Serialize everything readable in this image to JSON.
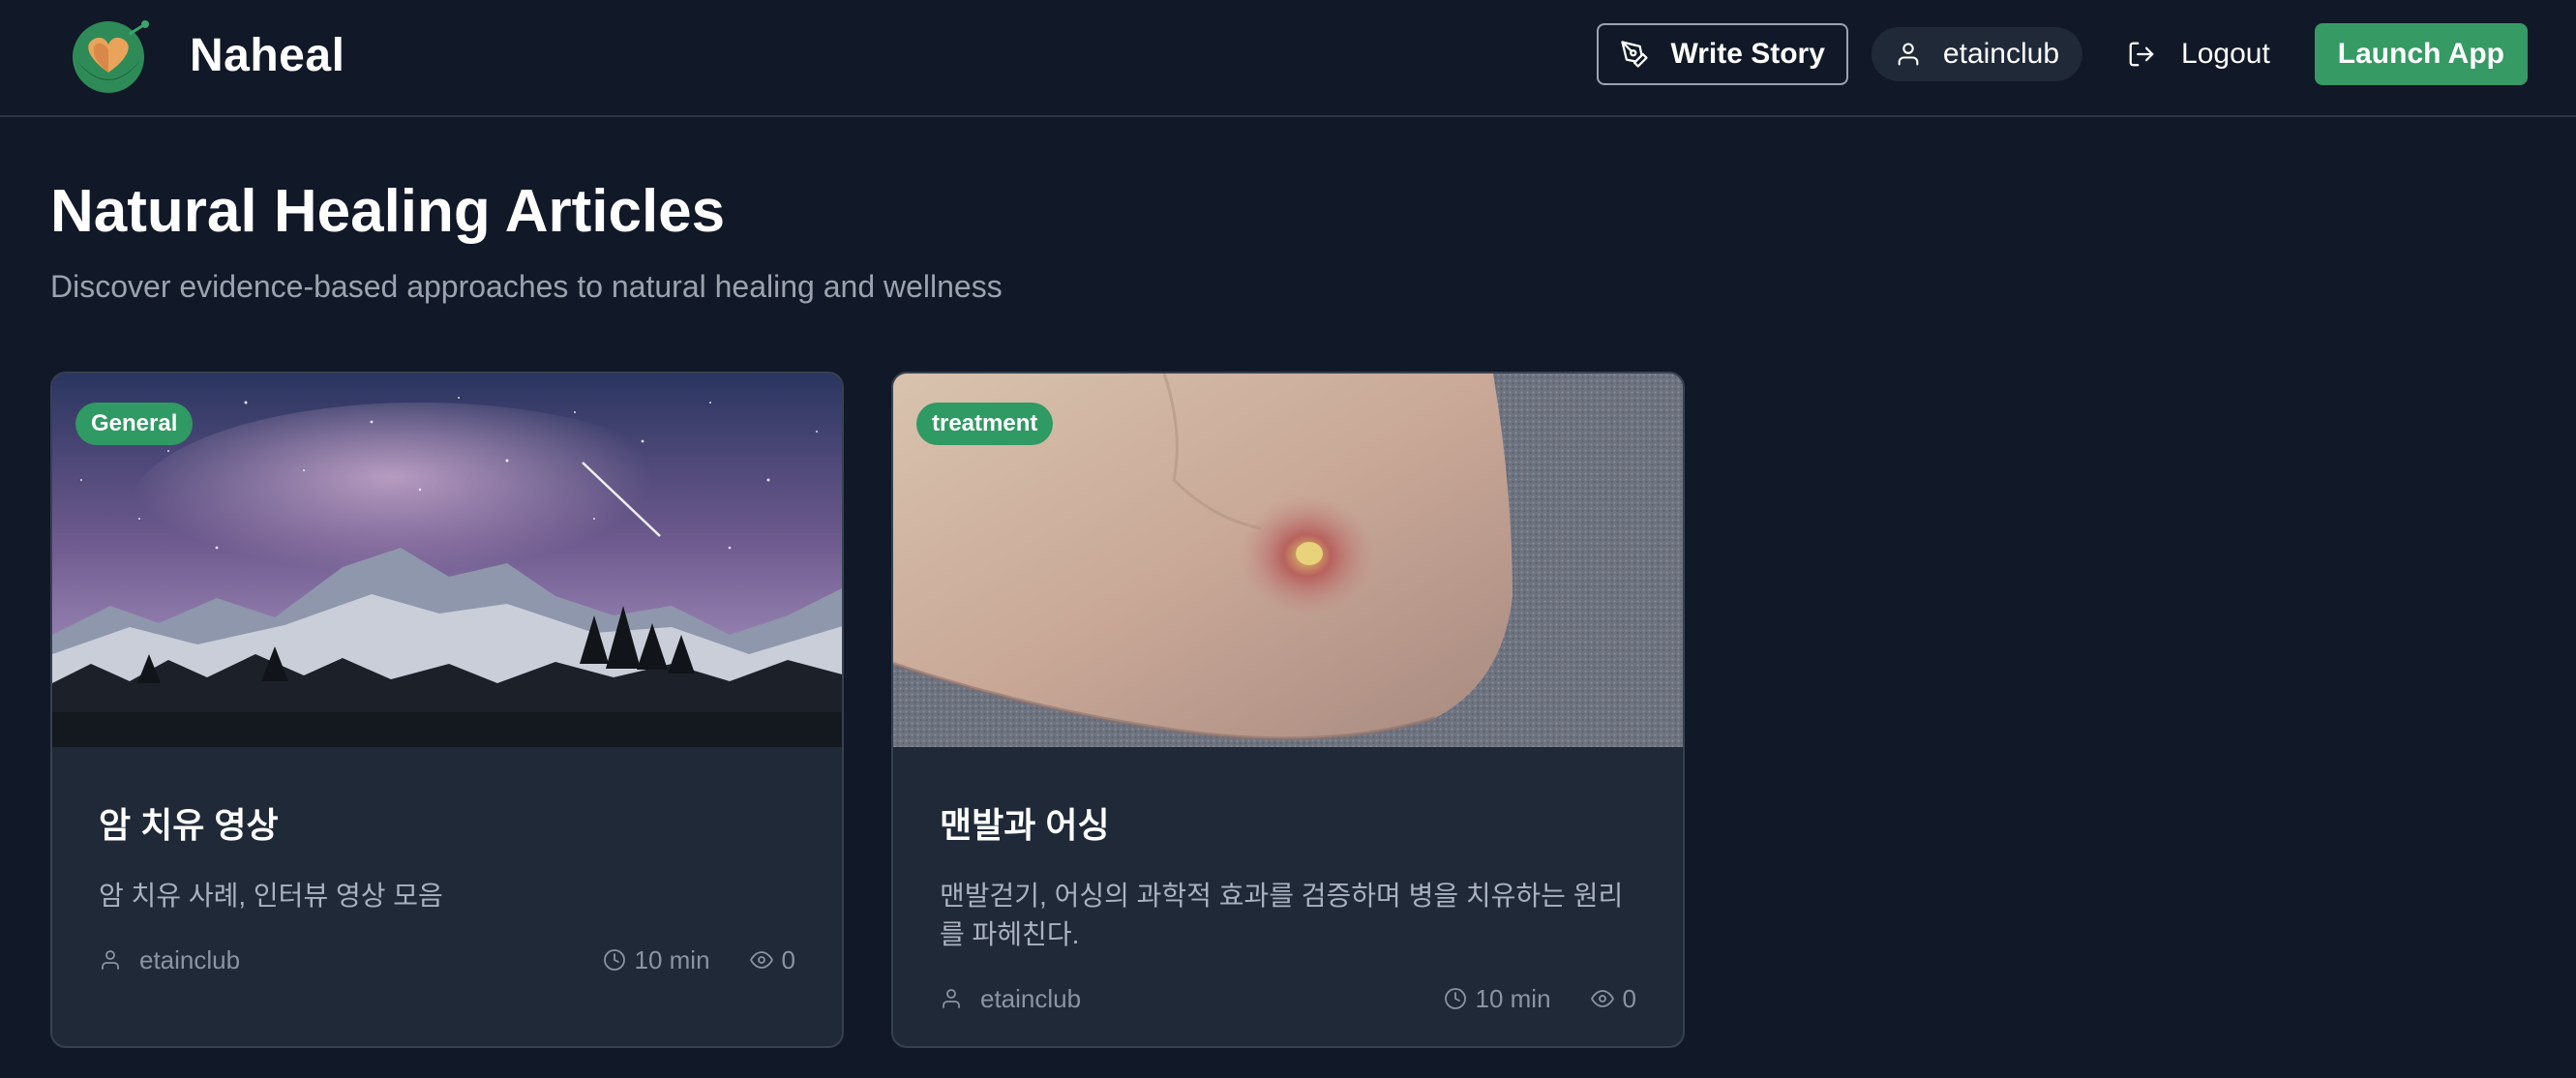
{
  "header": {
    "brand_name": "Naheal",
    "write_story_label": "Write Story",
    "username": "etainclub",
    "logout_label": "Logout",
    "launch_label": "Launch App"
  },
  "page": {
    "title": "Natural Healing Articles",
    "subtitle": "Discover evidence-based approaches to natural healing and wellness"
  },
  "articles": [
    {
      "category": "General",
      "title": "암 치유 영상",
      "description": "암 치유 사례, 인터뷰 영상 모음",
      "author": "etainclub",
      "read_time": "10 min",
      "views": "0"
    },
    {
      "category": "treatment",
      "title": "맨발과 어싱",
      "description": "맨발걷기, 어싱의 과학적 효과를 검증하며 병을 치유하는 원리를 파헤친다.",
      "author": "etainclub",
      "read_time": "10 min",
      "views": "0"
    }
  ],
  "colors": {
    "background": "#111827",
    "card": "#1f2937",
    "accent_green": "#359a63",
    "muted_text": "#9ca3af"
  },
  "icons": {
    "logo": "heart-leaf-logo",
    "write": "pen-nib-icon",
    "user": "user-icon",
    "logout": "logout-icon",
    "clock": "clock-icon",
    "views": "eye-icon"
  }
}
